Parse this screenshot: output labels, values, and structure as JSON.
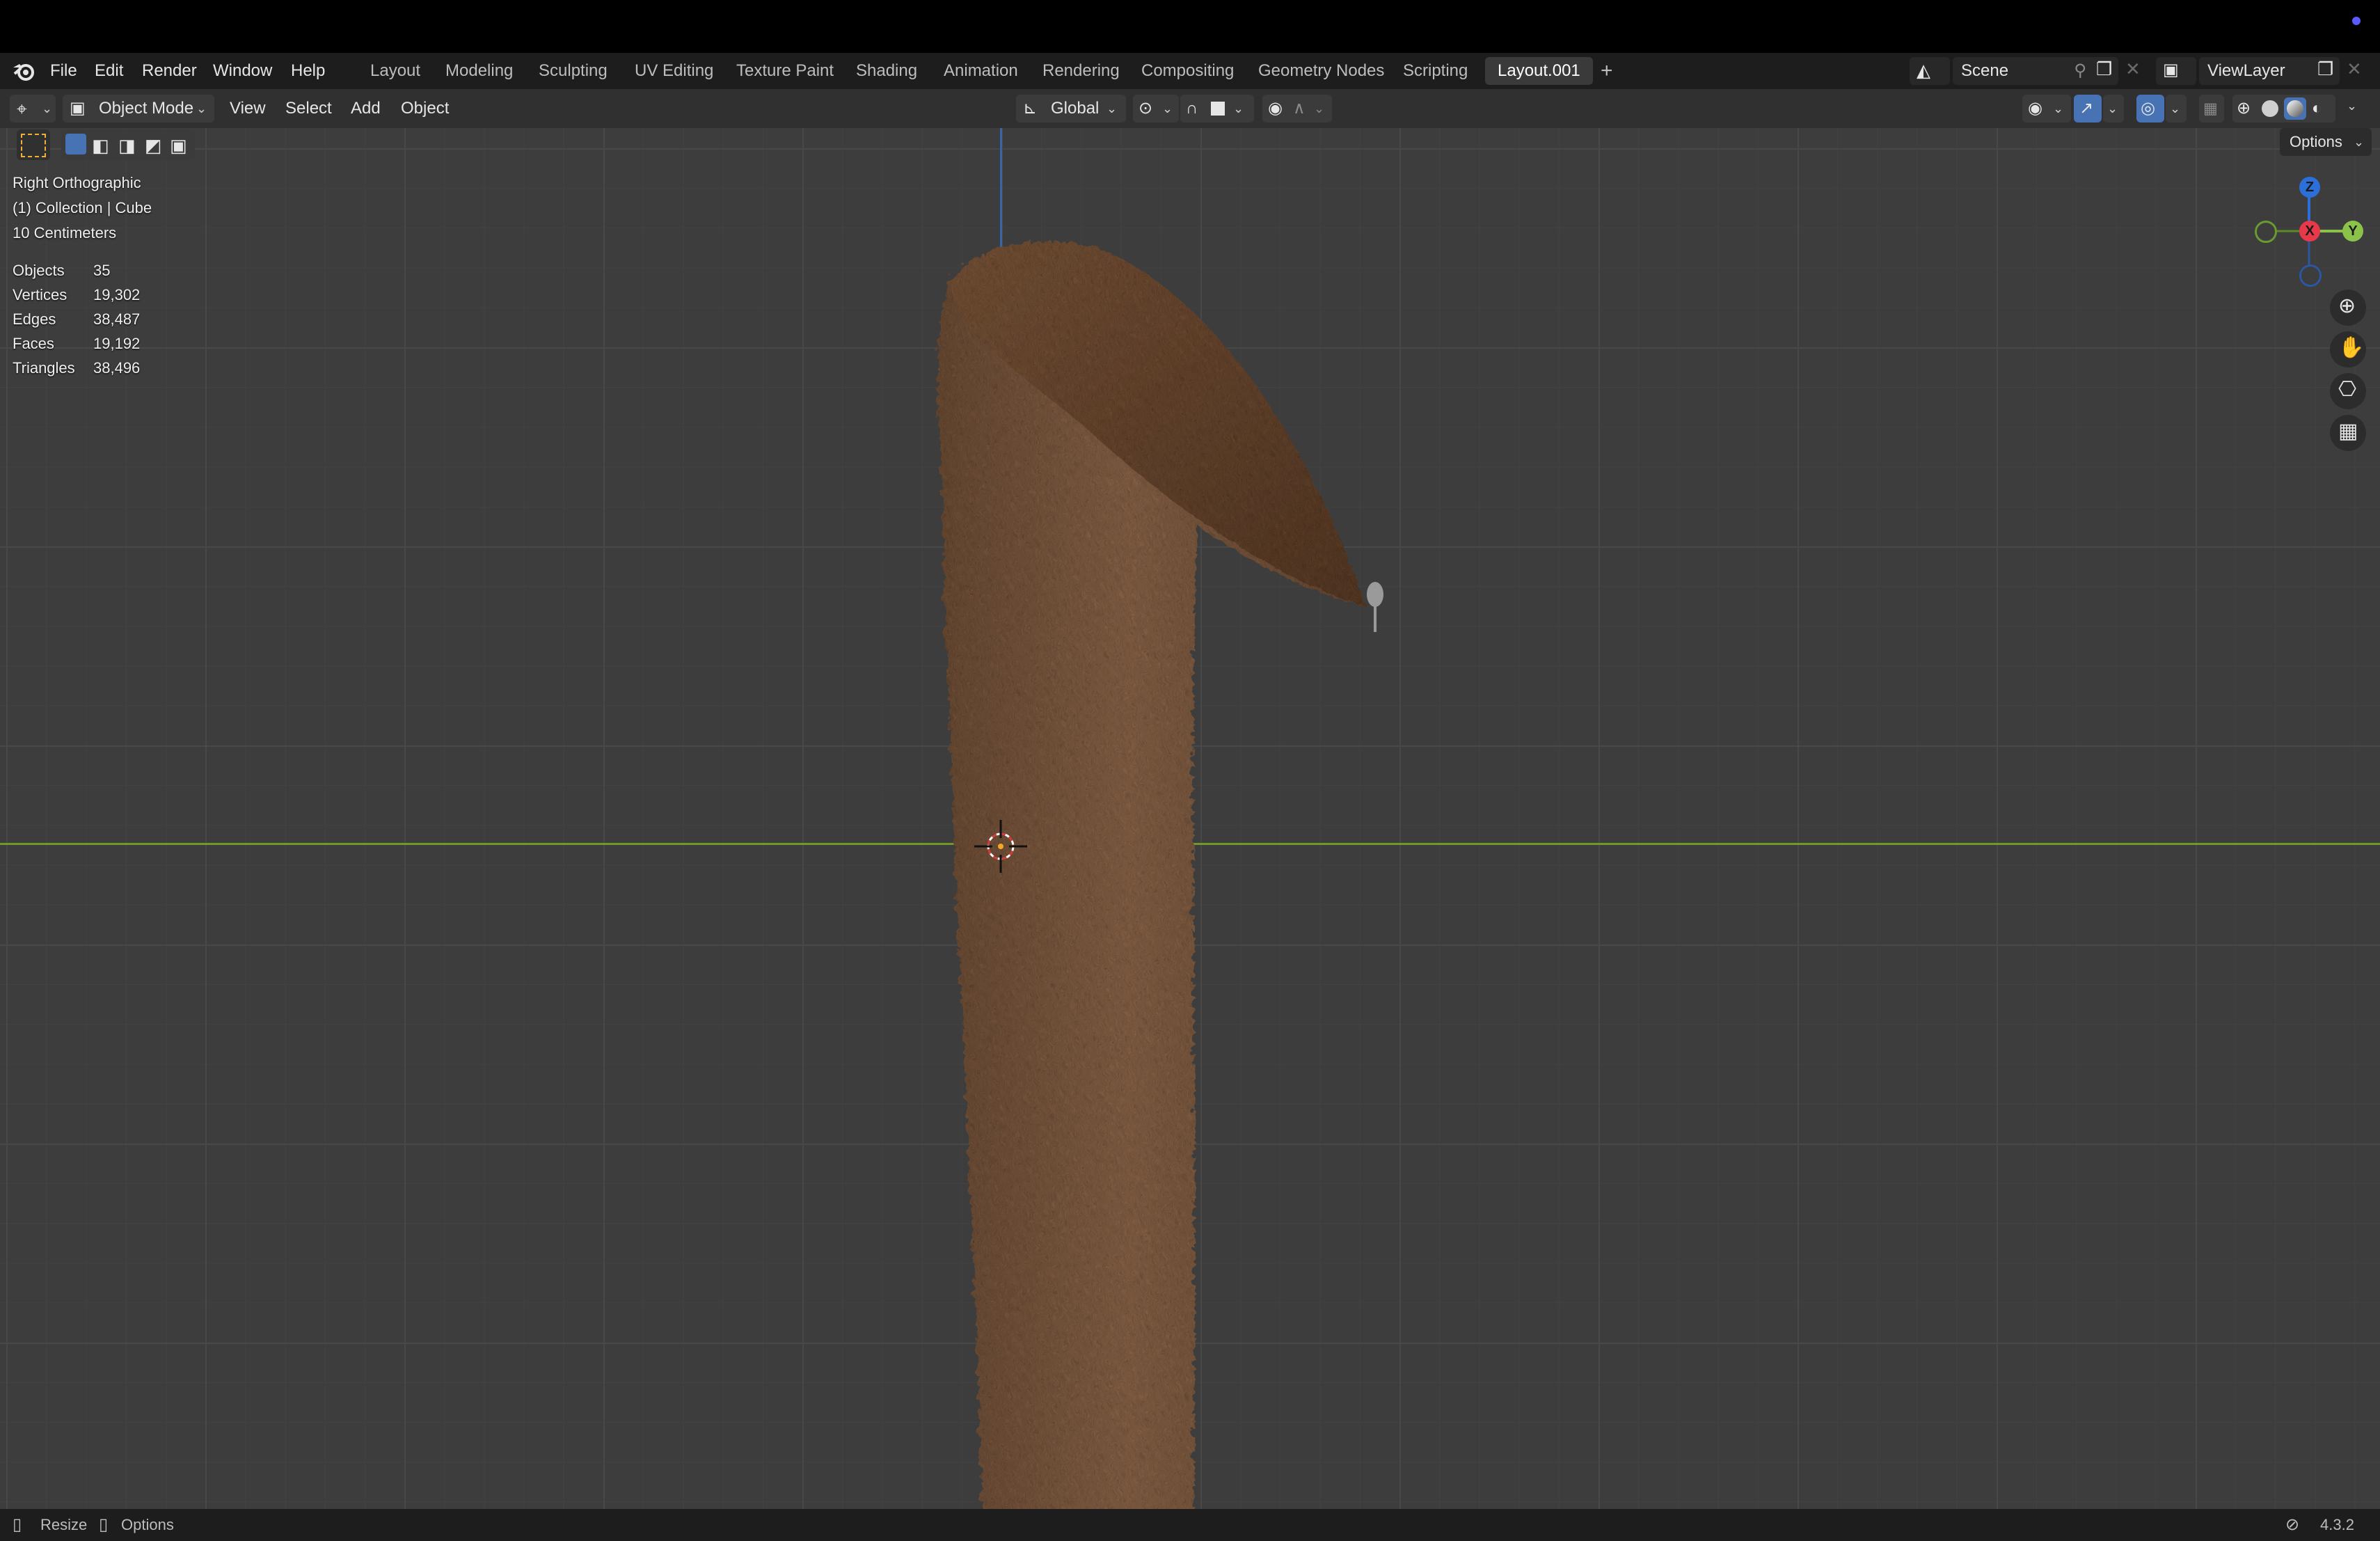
{
  "menu": [
    "File",
    "Edit",
    "Render",
    "Window",
    "Help"
  ],
  "workspaces": [
    "Layout",
    "Modeling",
    "Sculpting",
    "UV Editing",
    "Texture Paint",
    "Shading",
    "Animation",
    "Rendering",
    "Compositing",
    "Geometry Nodes",
    "Scripting",
    "Layout.001"
  ],
  "active_workspace": "Layout.001",
  "scene": {
    "name": "Scene"
  },
  "view_layer": {
    "name": "ViewLayer"
  },
  "viewport_header": {
    "mode": "Object Mode",
    "menus": [
      "View",
      "Select",
      "Add",
      "Object"
    ],
    "orientation": "Global",
    "options_label": "Options"
  },
  "overlay": {
    "view_name": "Right Orthographic",
    "collection": "(1) Collection | Cube",
    "grid_scale": "10 Centimeters",
    "stats": [
      {
        "label": "Objects",
        "value": "35"
      },
      {
        "label": "Vertices",
        "value": "19,302"
      },
      {
        "label": "Edges",
        "value": "38,487"
      },
      {
        "label": "Faces",
        "value": "19,192"
      },
      {
        "label": "Triangles",
        "value": "38,496"
      }
    ]
  },
  "gizmo": {
    "z": "Z",
    "x": "X",
    "y": "Y"
  },
  "status": {
    "left1": "Resize",
    "left2": "Options",
    "version": "4.3.2"
  },
  "colors": {
    "accent": "#4772b3",
    "fur": "#7d5a41",
    "axis_x": "#e8394a",
    "axis_y": "#8bc34a",
    "axis_z": "#2d6fd8"
  }
}
